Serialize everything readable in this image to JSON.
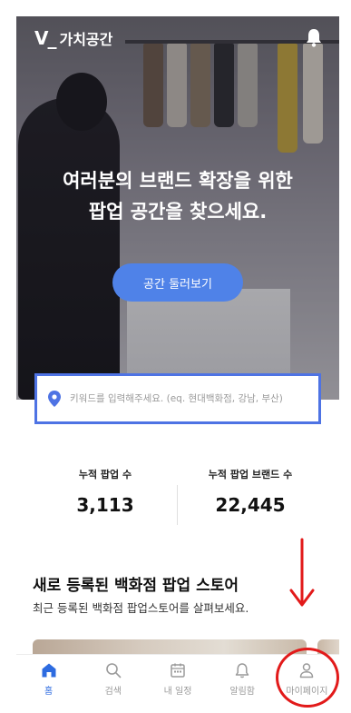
{
  "app": {
    "logo_mark": "V_",
    "name": "가치공간"
  },
  "hero": {
    "title": "여러분의 브랜드 확장을 위한\n팝업 공간을 찾으세요.",
    "button_label": "공간 둘러보기"
  },
  "search": {
    "placeholder": "키워드를 입력해주세요. (eq. 현대백화점, 강남, 부산)"
  },
  "stats": [
    {
      "label": "누적 팝업 수",
      "value": "3,113"
    },
    {
      "label": "누적 팝업 브랜드 수",
      "value": "22,445"
    }
  ],
  "section": {
    "title": "새로 등록된 백화점 팝업 스토어",
    "subtitle": "최근 등록된 백화점 팝업스토어를 살펴보세요."
  },
  "bottom_nav": {
    "items": [
      {
        "label": "홈",
        "icon": "home-icon",
        "active": true
      },
      {
        "label": "검색",
        "icon": "search-icon",
        "active": false
      },
      {
        "label": "내 일정",
        "icon": "calendar-icon",
        "active": false
      },
      {
        "label": "알림함",
        "icon": "bell-icon",
        "active": false
      },
      {
        "label": "마이페이지",
        "icon": "user-icon",
        "active": false
      }
    ]
  },
  "colors": {
    "accent": "#4f82e8",
    "active_nav": "#2d6be0",
    "search_border": "#4e73e4",
    "annotation": "#e21a1a"
  }
}
